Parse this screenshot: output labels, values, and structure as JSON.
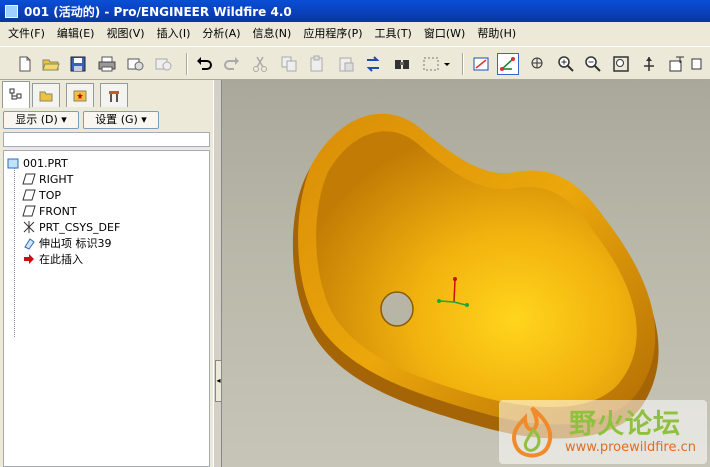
{
  "window": {
    "title": "001 (活动的) - Pro/ENGINEER Wildfire 4.0"
  },
  "menu": [
    "文件(F)",
    "编辑(E)",
    "视图(V)",
    "插入(I)",
    "分析(A)",
    "信息(N)",
    "应用程序(P)",
    "工具(T)",
    "窗口(W)",
    "帮助(H)"
  ],
  "panel": {
    "show_button": "显示",
    "settings_button": "设置",
    "tree": [
      "001.PRT",
      "RIGHT",
      "TOP",
      "FRONT",
      "PRT_CSYS_DEF",
      "伸出项 标识39",
      "在此插入"
    ]
  },
  "watermark": {
    "title": "野火论坛",
    "url": "www.proewildfire.cn"
  },
  "colors": {
    "model": "#e8a60a",
    "title_bar": "#0a46c8"
  }
}
